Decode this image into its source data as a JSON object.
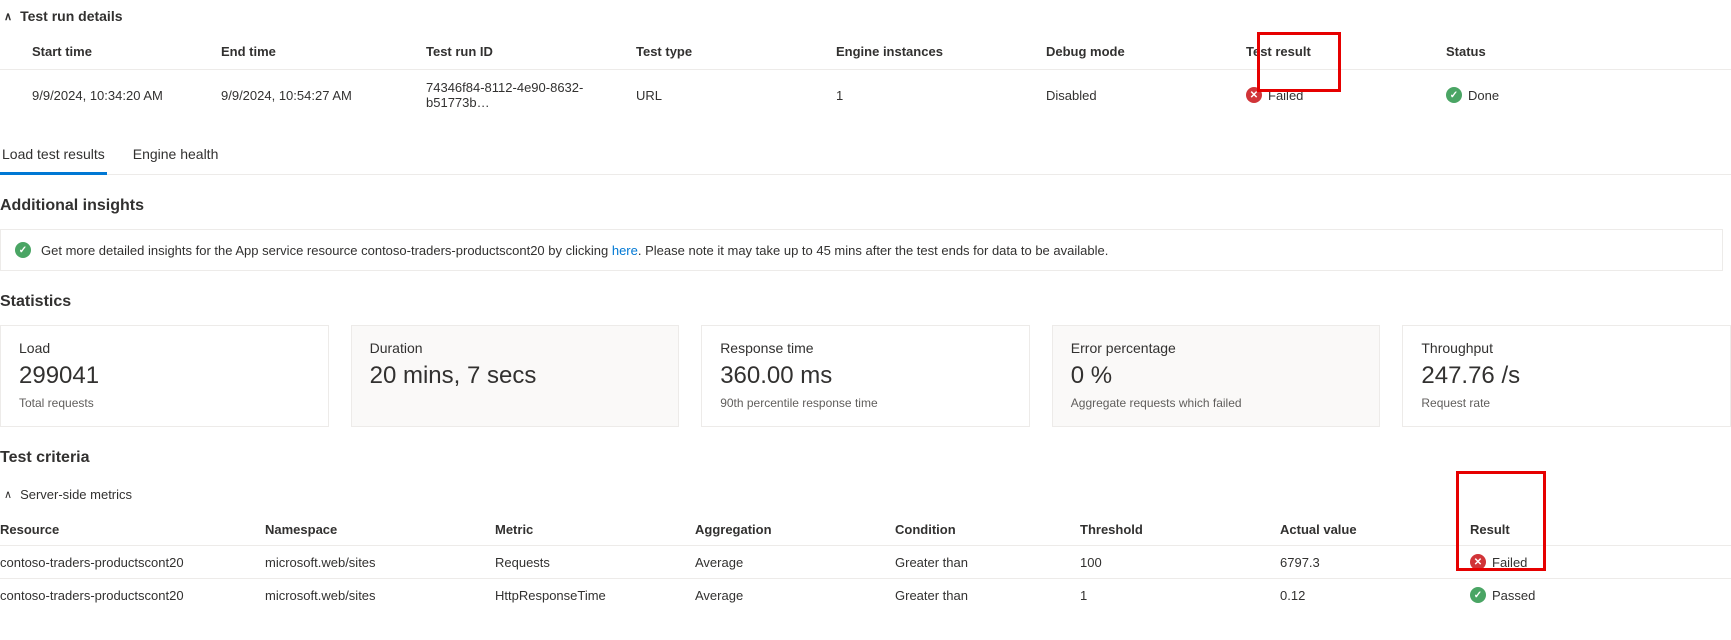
{
  "details": {
    "title": "Test run details",
    "headers": {
      "start": "Start time",
      "end": "End time",
      "runid": "Test run ID",
      "type": "Test type",
      "engines": "Engine instances",
      "debug": "Debug mode",
      "result": "Test result",
      "status": "Status"
    },
    "row": {
      "start": "9/9/2024, 10:34:20 AM",
      "end": "9/9/2024, 10:54:27 AM",
      "runid": "74346f84-8112-4e90-8632-b51773b…",
      "type": "URL",
      "engines": "1",
      "debug": "Disabled",
      "result": "Failed",
      "status": "Done"
    }
  },
  "tabs": {
    "loadResults": "Load test results",
    "engineHealth": "Engine health"
  },
  "insights": {
    "heading": "Additional insights",
    "text1": "Get more detailed insights for the App service resource contoso-traders-productscont20 by clicking ",
    "link": "here",
    "text2": ". Please note it may take up to 45 mins after the test ends for data to be available."
  },
  "statistics": {
    "heading": "Statistics",
    "load": {
      "label": "Load",
      "value": "299041",
      "sub": "Total requests"
    },
    "duration": {
      "label": "Duration",
      "value": "20 mins, 7 secs",
      "sub": ""
    },
    "response": {
      "label": "Response time",
      "value": "360.00 ms",
      "sub": "90th percentile response time"
    },
    "error": {
      "label": "Error percentage",
      "value": "0 %",
      "sub": "Aggregate requests which failed"
    },
    "throughput": {
      "label": "Throughput",
      "value": "247.76 /s",
      "sub": "Request rate"
    }
  },
  "criteria": {
    "heading": "Test criteria",
    "subHeading": "Server-side metrics",
    "headers": {
      "resource": "Resource",
      "namespace": "Namespace",
      "metric": "Metric",
      "aggregation": "Aggregation",
      "condition": "Condition",
      "threshold": "Threshold",
      "actual": "Actual value",
      "result": "Result"
    },
    "rows": [
      {
        "resource": "contoso-traders-productscont20",
        "namespace": "microsoft.web/sites",
        "metric": "Requests",
        "aggregation": "Average",
        "condition": "Greater than",
        "threshold": "100",
        "actual": "6797.3",
        "result": "Failed",
        "resultIcon": "fail"
      },
      {
        "resource": "contoso-traders-productscont20",
        "namespace": "microsoft.web/sites",
        "metric": "HttpResponseTime",
        "aggregation": "Average",
        "condition": "Greater than",
        "threshold": "1",
        "actual": "0.12",
        "result": "Passed",
        "resultIcon": "pass"
      }
    ]
  }
}
